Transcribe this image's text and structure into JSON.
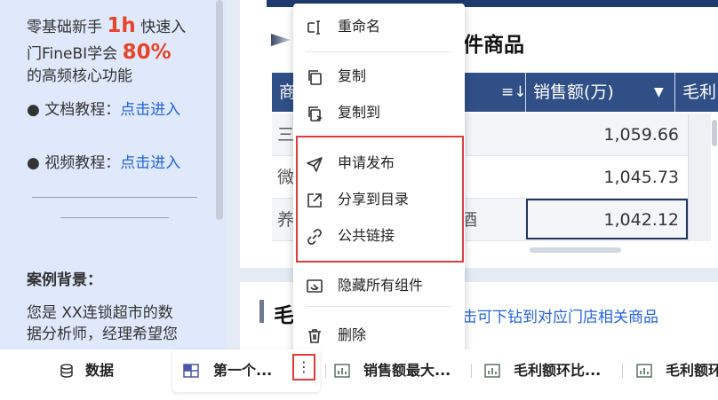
{
  "left_panel": {
    "intro_line1_pre": "零基础新手",
    "intro_line1_big": "1h",
    "intro_line1_post": "快速入",
    "intro_line2_pre": "门FineBI学会",
    "intro_line2_big": "80%",
    "intro_line3": "的高频核心功能",
    "doc_label": "● 文档教程：",
    "doc_link": "点击进入",
    "video_label": "● 视频教程：",
    "video_link": "点击进入",
    "case_title": "案例背景：",
    "case_line1": "您是 XX连锁超市的数",
    "case_line2": "据分析师，经理希望您"
  },
  "main_widget": {
    "title_tail": "件商品",
    "columns": [
      {
        "label": "商",
        "icon": ""
      },
      {
        "label": "",
        "icon": "sort-desc-icon"
      },
      {
        "label": "销售额(万)",
        "icon": "filter-icon"
      },
      {
        "label": "毛利",
        "icon": ""
      }
    ],
    "sort_glyph": "≡↓",
    "filter_glyph": "▼",
    "rows": [
      {
        "name": "三",
        "value": "1,059.66"
      },
      {
        "name": "微",
        "value": "1,045.73"
      },
      {
        "name": "养",
        "tail": "酒",
        "value": "1,042.12"
      }
    ]
  },
  "second_widget": {
    "title": "毛",
    "hint": "击可下钻到对应门店相关商品"
  },
  "context_menu": {
    "items": [
      {
        "label": "重命名",
        "icon": "rename-icon"
      },
      {
        "label": "复制",
        "icon": "copy-icon"
      },
      {
        "label": "复制到",
        "icon": "copy-to-icon"
      },
      {
        "label": "申请发布",
        "icon": "send-icon"
      },
      {
        "label": "分享到目录",
        "icon": "share-icon"
      },
      {
        "label": "公共链接",
        "icon": "link-icon"
      },
      {
        "label": "隐藏所有组件",
        "icon": "hide-icon"
      },
      {
        "label": "删除",
        "icon": "trash-icon"
      }
    ]
  },
  "tabbar": {
    "data_tab": "数据",
    "tabs": [
      {
        "label": "第一个...",
        "icon": "dashboard-icon"
      },
      {
        "label": "销售额最大...",
        "icon": "chart-icon"
      },
      {
        "label": "毛利额环比...",
        "icon": "chart-icon"
      },
      {
        "label": "毛利额环",
        "icon": "chart-icon"
      }
    ],
    "more_glyph": "⋮"
  },
  "colors": {
    "accent_red": "#e8432b",
    "link_blue": "#2563d8",
    "header_navy": "#2f4f86",
    "highlight_red": "#e03b3b"
  }
}
